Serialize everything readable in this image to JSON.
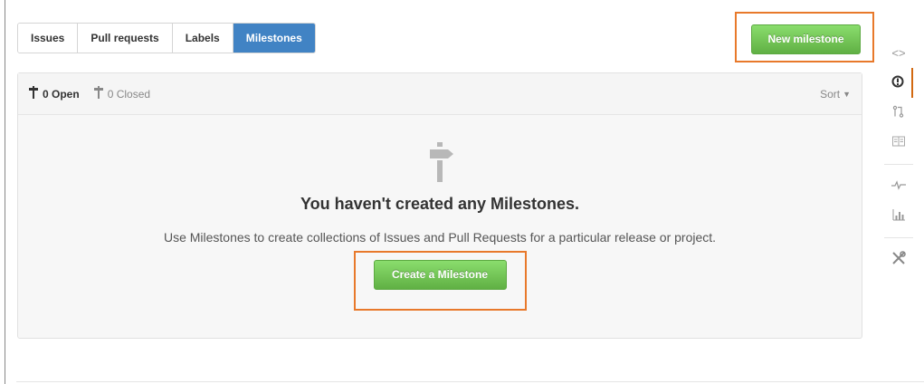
{
  "tabs": [
    {
      "label": "Issues"
    },
    {
      "label": "Pull requests"
    },
    {
      "label": "Labels"
    },
    {
      "label": "Milestones"
    }
  ],
  "new_milestone_label": "New milestone",
  "filters": {
    "open_label": "0 Open",
    "closed_label": "0 Closed",
    "sort_label": "Sort"
  },
  "empty_state": {
    "title": "You haven't created any Milestones.",
    "description": "Use Milestones to create collections of Issues and Pull Requests for a particular release or project.",
    "button_label": "Create a Milestone"
  },
  "sidebar_icons": [
    "code-icon",
    "issue-icon",
    "pull-request-icon",
    "wiki-icon",
    "pulse-icon",
    "graphs-icon",
    "settings-icon"
  ],
  "colors": {
    "accent_blue": "#4183c4",
    "button_green": "#6cc644",
    "highlight_orange": "#e8792b"
  }
}
